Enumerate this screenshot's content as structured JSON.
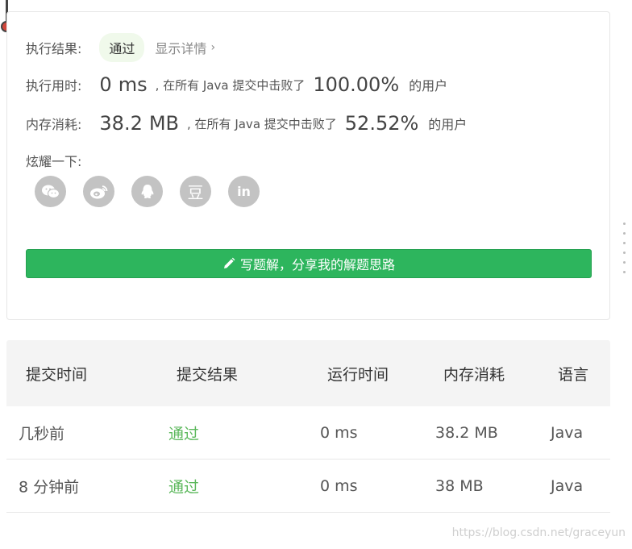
{
  "result": {
    "label": "执行结果:",
    "status": "通过",
    "detail_link": "显示详情",
    "detail_chevron": "›"
  },
  "runtime": {
    "label": "执行用时:",
    "value": "0",
    "unit": "ms",
    "beat_text": ", 在所有 Java 提交中击败了",
    "percent": "100.00%",
    "users_text": "的用户"
  },
  "memory": {
    "label": "内存消耗:",
    "value": "38.2",
    "unit": "MB",
    "beat_text": ", 在所有 Java 提交中击败了",
    "percent": "52.52%",
    "users_text": "的用户"
  },
  "share": {
    "label": "炫耀一下:",
    "icons": [
      "wechat-icon",
      "weibo-icon",
      "qq-icon",
      "douban-icon",
      "linkedin-icon"
    ],
    "douban_glyph": "豆",
    "linkedin_glyph": "in"
  },
  "write_button": {
    "label": "写题解，分享我的解题思路",
    "icon": "pencil-icon",
    "color": "#2db55d"
  },
  "table": {
    "headers": [
      "提交时间",
      "提交结果",
      "运行时间",
      "内存消耗",
      "语言"
    ],
    "rows": [
      {
        "time": "几秒前",
        "result": "通过",
        "runtime": "0 ms",
        "memory": "38.2 MB",
        "language": "Java"
      },
      {
        "time": "8 分钟前",
        "result": "通过",
        "runtime": "0 ms",
        "memory": "38 MB",
        "language": "Java"
      }
    ]
  },
  "watermark": "https://blog.csdn.net/graceyun",
  "colors": {
    "pass": "#5cb85c",
    "accent": "#2db55d",
    "badge_bg": "#f0f9eb"
  }
}
